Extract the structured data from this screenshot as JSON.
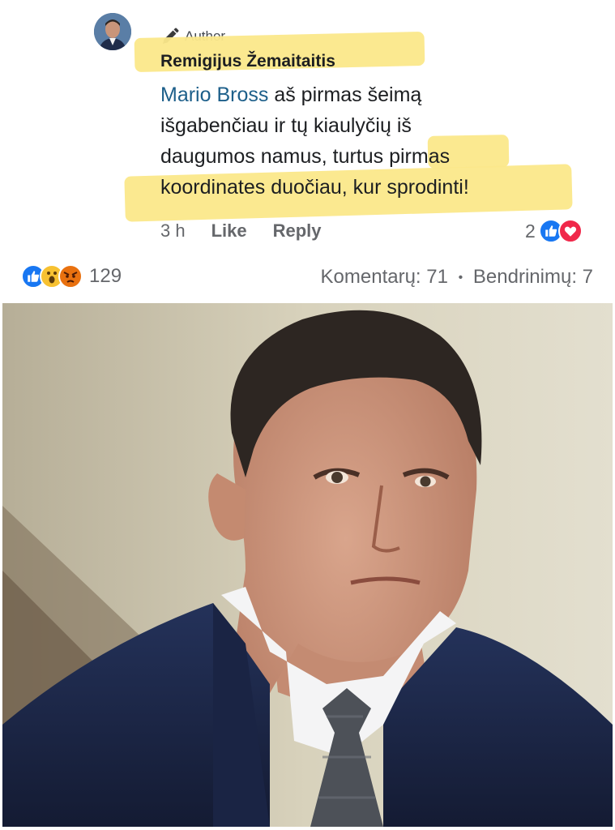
{
  "comment": {
    "author_badge": "Author",
    "commenter_name": "Remigijus Žemaitaitis",
    "mention": "Mario Bross",
    "text_line1_rest": " aš pirmas šeimą",
    "text_line2": "išgabenčiau ir tų kiaulyčių iš",
    "text_line3": "daugumos namus, turtus pirmas",
    "text_line4": "koordinates duočiau, kur sprodinti!",
    "time": "3 h",
    "like_label": "Like",
    "reply_label": "Reply",
    "reaction_count": "2",
    "reaction_icons": [
      "like-icon",
      "love-icon"
    ]
  },
  "post": {
    "reaction_count": "129",
    "reaction_icons": [
      "like-icon",
      "wow-icon",
      "angry-icon"
    ],
    "comments_label": "Komentarų: 71",
    "separator": "•",
    "shares_label": "Bendrinimų: 7"
  },
  "colors": {
    "highlight": "#fbe88a",
    "mention": "#1d5f8a",
    "like": "#1877f2",
    "love": "#f0284a",
    "wow": "#f7c131",
    "angry": "#e9710f",
    "muted_text": "#65676b"
  }
}
